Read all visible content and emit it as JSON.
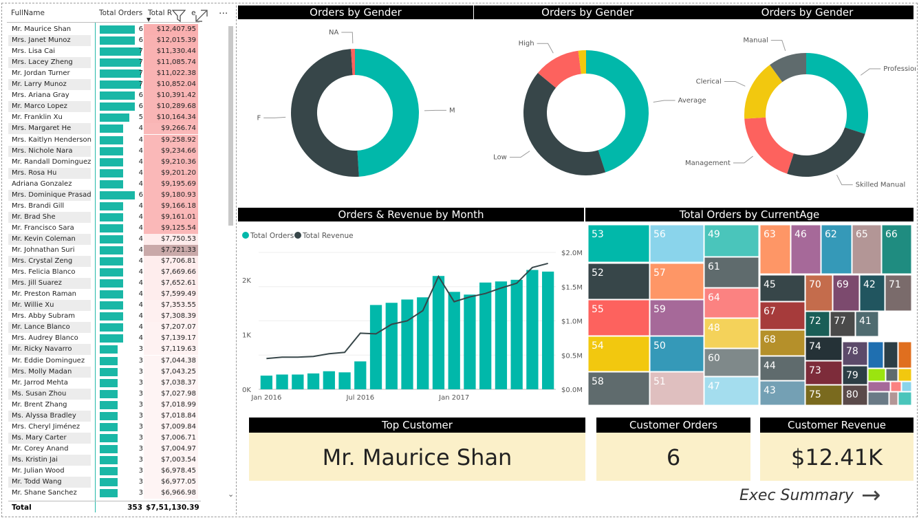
{
  "table": {
    "col_name": "FullName",
    "col_orders": "Total Orders",
    "col_revenue": "Total R",
    "col_revenue_suffix": "e",
    "more_label": "···",
    "scroll_down": "⌄",
    "rows": [
      {
        "name": "Mr. Maurice Shan",
        "orders": 6,
        "revenue": "$12,407.95"
      },
      {
        "name": "Mrs. Janet Munoz",
        "orders": 6,
        "revenue": "$12,015.39"
      },
      {
        "name": "Mrs. Lisa Cai",
        "orders": 7,
        "revenue": "$11,330.44"
      },
      {
        "name": "Mrs. Lacey Zheng",
        "orders": 7,
        "revenue": "$11,085.74"
      },
      {
        "name": "Mr. Jordan Turner",
        "orders": 7,
        "revenue": "$11,022.38"
      },
      {
        "name": "Mr. Larry Munoz",
        "orders": 7,
        "revenue": "$10,852.04"
      },
      {
        "name": "Mrs. Ariana Gray",
        "orders": 6,
        "revenue": "$10,391.42"
      },
      {
        "name": "Mr. Marco Lopez",
        "orders": 6,
        "revenue": "$10,289.68"
      },
      {
        "name": "Mr. Franklin Xu",
        "orders": 5,
        "revenue": "$10,164.34"
      },
      {
        "name": "Mrs. Margaret He",
        "orders": 4,
        "revenue": "$9,266.74"
      },
      {
        "name": "Mrs. Kaitlyn Henderson",
        "orders": 4,
        "revenue": "$9,258.92"
      },
      {
        "name": "Mrs. Nichole Nara",
        "orders": 4,
        "revenue": "$9,234.66"
      },
      {
        "name": "Mr. Randall Dominguez",
        "orders": 4,
        "revenue": "$9,210.36"
      },
      {
        "name": "Mrs. Rosa Hu",
        "orders": 4,
        "revenue": "$9,201.20"
      },
      {
        "name": "Adriana Gonzalez",
        "orders": 4,
        "revenue": "$9,195.69"
      },
      {
        "name": "Mrs. Dominique Prasad",
        "orders": 6,
        "revenue": "$9,180.93"
      },
      {
        "name": "Mrs. Brandi Gill",
        "orders": 4,
        "revenue": "$9,166.18"
      },
      {
        "name": "Mr. Brad She",
        "orders": 4,
        "revenue": "$9,161.01"
      },
      {
        "name": "Mr. Francisco Sara",
        "orders": 4,
        "revenue": "$9,125.54"
      },
      {
        "name": "Mr. Kevin Coleman",
        "orders": 4,
        "revenue": "$7,750.53"
      },
      {
        "name": "Mr. Johnathan Suri",
        "orders": 4,
        "revenue": "$7,721.33"
      },
      {
        "name": "Mrs. Crystal Zeng",
        "orders": 4,
        "revenue": "$7,706.81"
      },
      {
        "name": "Mrs. Felicia Blanco",
        "orders": 4,
        "revenue": "$7,669.66"
      },
      {
        "name": "Mrs. Jill Suarez",
        "orders": 4,
        "revenue": "$7,652.61"
      },
      {
        "name": "Mr. Preston Raman",
        "orders": 4,
        "revenue": "$7,599.49"
      },
      {
        "name": "Mr. Willie Xu",
        "orders": 4,
        "revenue": "$7,353.55"
      },
      {
        "name": "Mrs. Abby Subram",
        "orders": 4,
        "revenue": "$7,308.39"
      },
      {
        "name": "Mr. Lance Blanco",
        "orders": 4,
        "revenue": "$7,207.07"
      },
      {
        "name": "Mrs. Audrey Blanco",
        "orders": 4,
        "revenue": "$7,139.17"
      },
      {
        "name": "Mr. Ricky Navarro",
        "orders": 3,
        "revenue": "$7,119.63"
      },
      {
        "name": "Mr. Eddie Dominguez",
        "orders": 3,
        "revenue": "$7,044.38"
      },
      {
        "name": "Mrs. Molly Madan",
        "orders": 3,
        "revenue": "$7,043.25"
      },
      {
        "name": "Mr. Jarrod Mehta",
        "orders": 3,
        "revenue": "$7,038.37"
      },
      {
        "name": "Ms. Susan Zhou",
        "orders": 3,
        "revenue": "$7,027.98"
      },
      {
        "name": "Mr. Brent Zhang",
        "orders": 3,
        "revenue": "$7,018.99"
      },
      {
        "name": "Ms. Alyssa Bradley",
        "orders": 3,
        "revenue": "$7,018.84"
      },
      {
        "name": "Mrs. Cheryl Jiménez",
        "orders": 3,
        "revenue": "$7,009.84"
      },
      {
        "name": "Ms. Mary Carter",
        "orders": 3,
        "revenue": "$7,006.71"
      },
      {
        "name": "Mr. Corey Anand",
        "orders": 3,
        "revenue": "$7,004.97"
      },
      {
        "name": "Ms. Kristin Jai",
        "orders": 3,
        "revenue": "$7,003.54"
      },
      {
        "name": "Mr. Julian Wood",
        "orders": 3,
        "revenue": "$6,978.45"
      },
      {
        "name": "Mr. Todd Wang",
        "orders": 3,
        "revenue": "$6,977.05"
      },
      {
        "name": "Mr. Shane Sanchez",
        "orders": 3,
        "revenue": "$6,966.98"
      }
    ],
    "total_label": "Total",
    "total_orders": "353",
    "total_revenue": "$7,51,130.39"
  },
  "donuts": {
    "gender": {
      "title": "Orders by Gender",
      "slices": [
        {
          "label": "M",
          "value": 49,
          "color": "#01b8aa"
        },
        {
          "label": "F",
          "value": 50,
          "color": "#374649"
        },
        {
          "label": "NA",
          "value": 1,
          "color": "#fd625e"
        }
      ]
    },
    "income": {
      "title": "Orders by Gender",
      "slices": [
        {
          "label": "Average",
          "value": 45,
          "color": "#01b8aa"
        },
        {
          "label": "Low",
          "value": 41,
          "color": "#374649"
        },
        {
          "label": "High",
          "value": 12,
          "color": "#fd625e"
        },
        {
          "label": "",
          "value": 2,
          "color": "#f2c80f"
        }
      ]
    },
    "occupation": {
      "title": "Orders by Gender",
      "slices": [
        {
          "label": "Professional",
          "value": 30,
          "color": "#01b8aa"
        },
        {
          "label": "Skilled Manual",
          "value": 25,
          "color": "#374649"
        },
        {
          "label": "Management",
          "value": 19,
          "color": "#fd625e"
        },
        {
          "label": "Clerical",
          "value": 16,
          "color": "#f2c80f"
        },
        {
          "label": "Manual",
          "value": 10,
          "color": "#5f6b6d"
        }
      ]
    }
  },
  "combo": {
    "title": "Orders & Revenue by Month",
    "legend": [
      {
        "label": "Total Orders",
        "color": "#01b8aa"
      },
      {
        "label": "Total Revenue",
        "color": "#374649"
      }
    ],
    "chart_data": {
      "type": "bar",
      "categories": [
        "Jan 2016",
        "Feb 2016",
        "Mar 2016",
        "Apr 2016",
        "May 2016",
        "Jun 2016",
        "Jul 2016",
        "Aug 2016",
        "Sep 2016",
        "Oct 2016",
        "Nov 2016",
        "Dec 2016",
        "Jan 2017",
        "Feb 2017",
        "Mar 2017",
        "Apr 2017",
        "May 2017",
        "Jun 2017",
        "Jul 2017"
      ],
      "series": [
        {
          "name": "Total Orders",
          "axis": "left",
          "values": [
            250,
            270,
            270,
            290,
            330,
            310,
            510,
            1540,
            1580,
            1640,
            1680,
            2070,
            1780,
            1730,
            1950,
            1970,
            2000,
            2180,
            2150
          ]
        },
        {
          "name": "Total Revenue",
          "axis": "right",
          "values": [
            0.45,
            0.47,
            0.47,
            0.48,
            0.52,
            0.54,
            0.82,
            0.81,
            0.95,
            1.0,
            1.15,
            1.65,
            1.28,
            1.35,
            1.4,
            1.48,
            1.55,
            1.78,
            1.84
          ]
        }
      ],
      "x_ticks": [
        "Jan 2016",
        "Jul 2016",
        "Jan 2017"
      ],
      "y_left_ticks": [
        "0K",
        "1K",
        "2K"
      ],
      "y_left_range": [
        0,
        2500
      ],
      "y_right_ticks": [
        "$0.0M",
        "$0.5M",
        "$1.0M",
        "$1.5M",
        "$2.0M"
      ],
      "y_right_range": [
        0,
        2.0
      ],
      "grid": true,
      "legend_position": "top-left"
    }
  },
  "treemap": {
    "title": "Total Orders by CurrentAge",
    "ages": [
      "53",
      "56",
      "49",
      "63",
      "46",
      "62",
      "65",
      "66",
      "52",
      "57",
      "61",
      "45",
      "70",
      "69",
      "42",
      "71",
      "55",
      "59",
      "64",
      "67",
      "72",
      "77",
      "41",
      "54",
      "50",
      "48",
      "68",
      "74",
      "78",
      "60",
      "44",
      "73",
      "79",
      "58",
      "51",
      "47",
      "43",
      "75",
      "80"
    ]
  },
  "cards": {
    "top_customer": {
      "title": "Top Customer",
      "value": "Mr. Maurice Shan"
    },
    "customer_orders": {
      "title": "Customer Orders",
      "value": "6"
    },
    "customer_revenue": {
      "title": "Customer Revenue",
      "value": "$12.41K"
    }
  },
  "nav": {
    "label": "Exec Summary",
    "arrow": "→"
  }
}
